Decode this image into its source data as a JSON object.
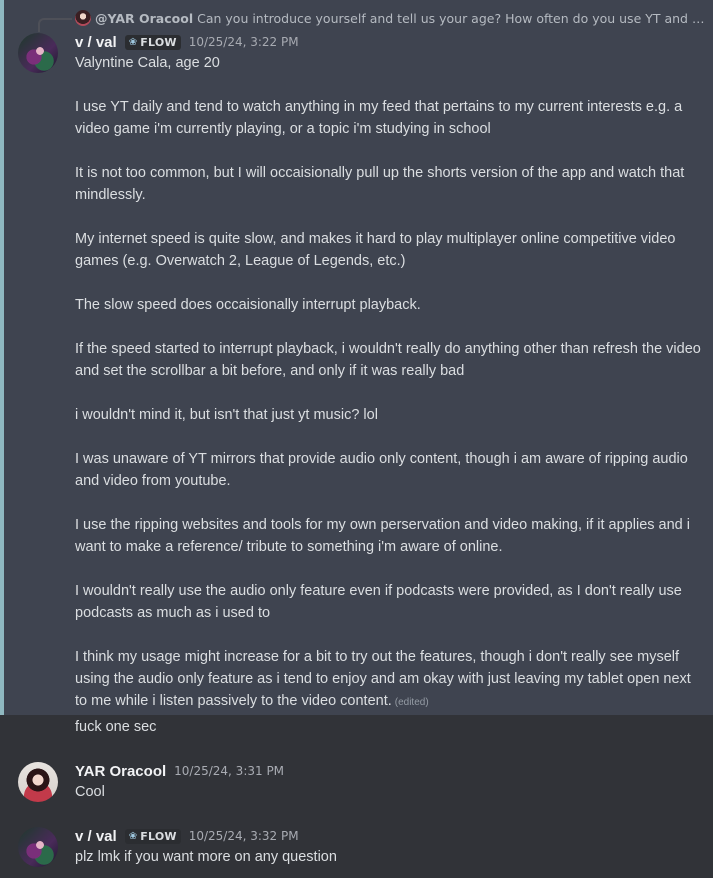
{
  "reply": {
    "author": "@YAR Oracool",
    "text": "Can you introduce yourself and tell us your age? How often do you use YT and what do..."
  },
  "messages": [
    {
      "author": "v / val",
      "tag": "FLOW",
      "timestamp": "10/25/24, 3:22 PM",
      "paragraphs": [
        "Valyntine Cala, age 20",
        "I use YT daily and tend to watch anything in my feed that pertains to my current interests e.g. a video game i'm currently playing, or a topic i'm studying in school",
        "It is not too common, but I will occaisionally pull up the shorts version of the app and watch that mindlessly.",
        "My internet speed is quite slow, and makes it hard to play multiplayer online competitive video games (e.g. Overwatch 2, League of Legends, etc.)",
        "The slow speed does occaisionally interrupt playback.",
        "If the speed started to interrupt playback, i wouldn't really do anything other than refresh the video and set the scrollbar a bit before, and only if it was really bad",
        "i wouldn't mind it, but isn't that just yt music? lol",
        "I was unaware of YT mirrors that provide audio only content, though i am aware of ripping audio and video from youtube.",
        "I use the ripping websites and tools for my own perservation and video making, if it applies and i want to make a reference/ tribute to something i'm aware of online.",
        "I wouldn't really use the audio only feature even if podcasts were provided, as I don't really use podcasts as much as i used to",
        "I think my usage might increase for a bit to try out the features, though i don't really see myself using the audio only feature as i tend to enjoy and am okay with just leaving my tablet open next to me while i listen passively to the video content."
      ],
      "edited": "(edited)"
    },
    {
      "text": "fuck one sec"
    },
    {
      "author": "YAR Oracool",
      "timestamp": "10/25/24, 3:31 PM",
      "text": "Cool"
    },
    {
      "author": "v / val",
      "tag": "FLOW",
      "timestamp": "10/25/24, 3:32 PM",
      "text": "plz lmk if you want more on any question"
    }
  ],
  "colors": {
    "background": "#313338",
    "highlight": "#3f4450",
    "highlight_bar": "#8fb8c0",
    "text": "#dbdee1",
    "muted": "#a8abb2"
  },
  "icons": [
    "avatar-val",
    "avatar-yar",
    "flow-tag-icon",
    "reply-avatar"
  ]
}
